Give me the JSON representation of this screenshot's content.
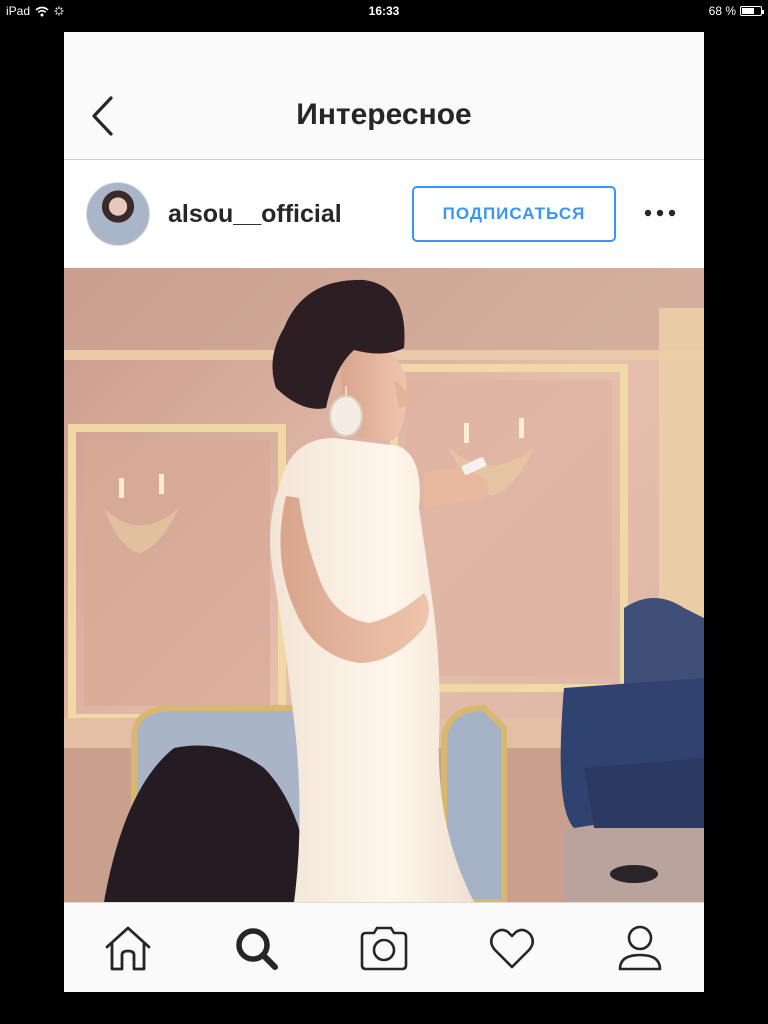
{
  "status_bar": {
    "device": "iPad",
    "time": "16:33",
    "battery_text": "68 %",
    "battery_level": 0.68
  },
  "header": {
    "title": "Интересное",
    "back_icon": "chevron-left-icon"
  },
  "post": {
    "username": "alsou__official",
    "follow_label": "ПОДПИСАТЬСЯ",
    "more_icon": "more-dots-icon"
  },
  "tab_bar": {
    "tabs": [
      {
        "icon": "home-icon"
      },
      {
        "icon": "search-icon",
        "active": true
      },
      {
        "icon": "camera-icon"
      },
      {
        "icon": "heart-icon"
      },
      {
        "icon": "profile-icon"
      }
    ]
  },
  "colors": {
    "accent": "#3897f0",
    "text": "#262626",
    "bar_background": "#fafafa",
    "divider": "#dbdbdb"
  }
}
